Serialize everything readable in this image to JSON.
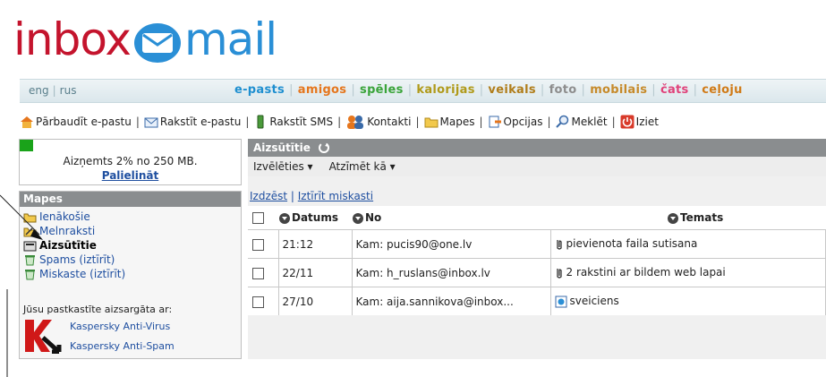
{
  "logo": {
    "part1": "inbox",
    "part2": "mail"
  },
  "nav": {
    "lang": [
      "eng",
      "rus"
    ],
    "links": [
      {
        "label": "e-pasts",
        "color": "#1f8fd0"
      },
      {
        "label": "amigos",
        "color": "#e5761d"
      },
      {
        "label": "spēles",
        "color": "#3aa43a"
      },
      {
        "label": "kalorijas",
        "color": "#b09a1a"
      },
      {
        "label": "veikals",
        "color": "#b07d1a"
      },
      {
        "label": "foto",
        "color": "#8d8d8d"
      },
      {
        "label": "mobilais",
        "color": "#c68a2a"
      },
      {
        "label": "čats",
        "color": "#e0427a"
      },
      {
        "label": "ceļoju",
        "color": "#d07a16"
      }
    ]
  },
  "toolbar": {
    "check": "Pārbaudīt e-pastu",
    "write": "Rakstīt e-pastu",
    "sms": "Rakstīt SMS",
    "contacts": "Kontakti",
    "folders": "Mapes",
    "options": "Opcijas",
    "search": "Meklēt",
    "exit": "Iziet"
  },
  "quota": {
    "text": "Aizņemts 2% no 250 MB.",
    "link": "Palielināt",
    "fill_fraction": 0.02
  },
  "folders": {
    "title": "Mapes",
    "inbox": "Ienākošie",
    "drafts": "Melnraksti",
    "sent": "Aizsūtītie",
    "spam": "Spams (iztīrīt)",
    "trash": "Miskaste (iztīrīt)"
  },
  "protection": {
    "label": "Jūsu pastkastīte aizsargāta ar:",
    "av": "Kaspersky Anti-Virus",
    "as": "Kaspersky Anti-Spam"
  },
  "main": {
    "title": "Aizsūtītie",
    "select": "Izvēlēties",
    "mark": "Atzīmēt kā",
    "delete": "Izdzēst",
    "empty_trash": "Iztīrīt miskasti",
    "col_date": "Datums",
    "col_to": "No",
    "col_subject": "Temats"
  },
  "messages": [
    {
      "date": "21:12",
      "to": "Kam: pucis90@one.lv",
      "subject": "pievienota faila sutisana"
    },
    {
      "date": "22/11",
      "to": "Kam: h_ruslans@inbox.lv",
      "subject": "2 rakstini ar bildem web lapai"
    },
    {
      "date": "27/10",
      "to": "Kam: aija.sannikova@inbox...",
      "subject": "sveiciens"
    }
  ]
}
